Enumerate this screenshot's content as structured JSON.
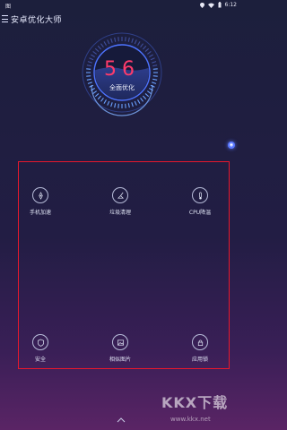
{
  "status_bar": {
    "left_icon_label": "图",
    "time": "6:12"
  },
  "app_bar": {
    "title": "安卓优化大师"
  },
  "gauge": {
    "score": "56",
    "action_label": "全面优化"
  },
  "features": [
    {
      "label": "手机加速",
      "icon": "rocket-icon"
    },
    {
      "label": "垃圾清理",
      "icon": "broom-icon"
    },
    {
      "label": "CPU降温",
      "icon": "thermometer-icon"
    },
    {
      "label": "安全",
      "icon": "shield-icon"
    },
    {
      "label": "相似图片",
      "icon": "image-icon"
    },
    {
      "label": "应用锁",
      "icon": "lock-icon"
    }
  ],
  "watermark": {
    "big": "KKX下载",
    "small": "www.kkx.net"
  },
  "colors": {
    "accent_red": "#ff3b6b",
    "highlight_box": "#e8182c",
    "gauge_blue": "#5a8cff"
  }
}
